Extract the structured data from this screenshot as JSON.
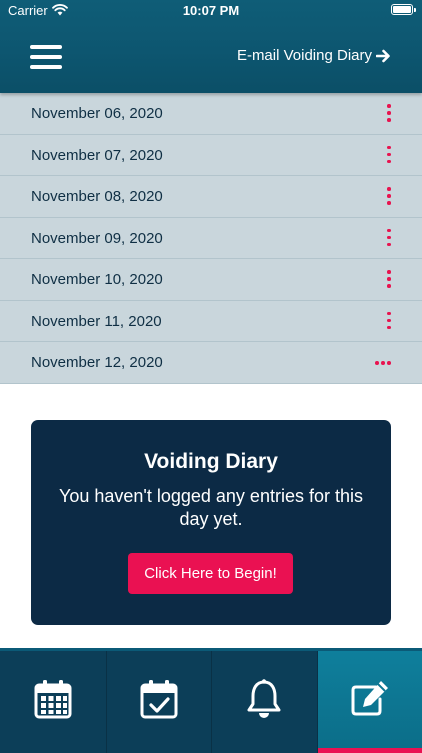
{
  "status_bar": {
    "carrier": "Carrier",
    "time": "10:07 PM"
  },
  "header": {
    "email_label": "E-mail Voiding Diary"
  },
  "dates": [
    "November 06, 2020",
    "November 07, 2020",
    "November 08, 2020",
    "November 09, 2020",
    "November 10, 2020",
    "November 11, 2020",
    "November 12, 2020"
  ],
  "card": {
    "title": "Voiding Diary",
    "message": "You haven't logged any entries for this day yet.",
    "button_label": "Click Here to Begin!"
  },
  "tabs": [
    {
      "icon": "calendar-icon"
    },
    {
      "icon": "calendar-check-icon"
    },
    {
      "icon": "bell-icon"
    },
    {
      "icon": "edit-icon",
      "active": true
    }
  ],
  "colors": {
    "header": "#0d5670",
    "accent": "#ea1152",
    "row": "#c9d6dc",
    "card": "#0c2a45",
    "tabbar": "#0c3e58"
  }
}
